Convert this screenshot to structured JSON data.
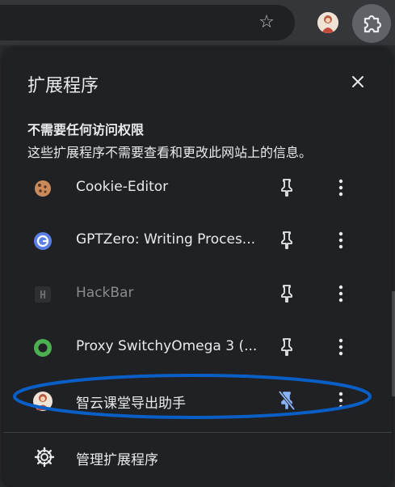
{
  "toolbar": {
    "bookmark_icon": "star-icon",
    "extensions_icon": "puzzle-icon"
  },
  "popup": {
    "title": "扩展程序",
    "close_icon": "close-icon",
    "section_title": "不需要任何访问权限",
    "section_desc": "这些扩展程序不需要查看和更改此网站上的信息。",
    "extensions": [
      {
        "name": "Cookie-Editor",
        "icon": "cookie-icon",
        "pinned": false,
        "disabled": false
      },
      {
        "name": "GPTZero: Writing Proces...",
        "icon": "gptzero-icon",
        "pinned": false,
        "disabled": false
      },
      {
        "name": "HackBar",
        "icon": "hackbar-icon",
        "pinned": false,
        "disabled": true
      },
      {
        "name": "Proxy SwitchyOmega 3 (...",
        "icon": "switchyomega-icon",
        "pinned": false,
        "disabled": false
      },
      {
        "name": "智云课堂导出助手",
        "icon": "avatar-icon",
        "pinned": true,
        "disabled": false
      }
    ],
    "manage_label": "管理扩展程序",
    "manage_icon": "gear-icon"
  },
  "colors": {
    "popup_bg": "#202124",
    "text": "#e8eaed",
    "accent_pin": "#8ab4f8",
    "annotation": "#0a5fc6"
  }
}
